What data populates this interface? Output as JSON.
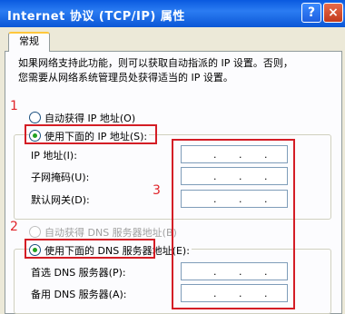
{
  "window": {
    "title": "Internet 协议 (TCP/IP) 属性",
    "help_icon": "?",
    "close_icon": "×"
  },
  "tabs": [
    {
      "label": "常规"
    }
  ],
  "description": {
    "line1": "如果网络支持此功能，则可以获取自动指派的 IP 设置。否则，",
    "line2": "您需要从网络系统管理员处获得适当的 IP 设置。"
  },
  "ip_section": {
    "auto_option": "自动获得 IP 地址(O)",
    "manual_option": "使用下面的 IP 地址(S):",
    "selected": "manual",
    "fields": [
      {
        "label": "IP 地址(I):",
        "value": " .  .  . "
      },
      {
        "label": "子网掩码(U):",
        "value": " .  .  . "
      },
      {
        "label": "默认网关(D):",
        "value": " .  .  . "
      }
    ]
  },
  "dns_section": {
    "auto_option": "自动获得 DNS 服务器地址(B)",
    "manual_option": "使用下面的 DNS 服务器地址(E):",
    "selected": "manual",
    "fields": [
      {
        "label": "首选 DNS 服务器(P):",
        "value": " .  .  . "
      },
      {
        "label": "备用 DNS 服务器(A):",
        "value": " .  .  . "
      }
    ]
  },
  "annotations": {
    "n1": "1",
    "n2": "2",
    "n3": "3",
    "color": "#d41d25"
  }
}
